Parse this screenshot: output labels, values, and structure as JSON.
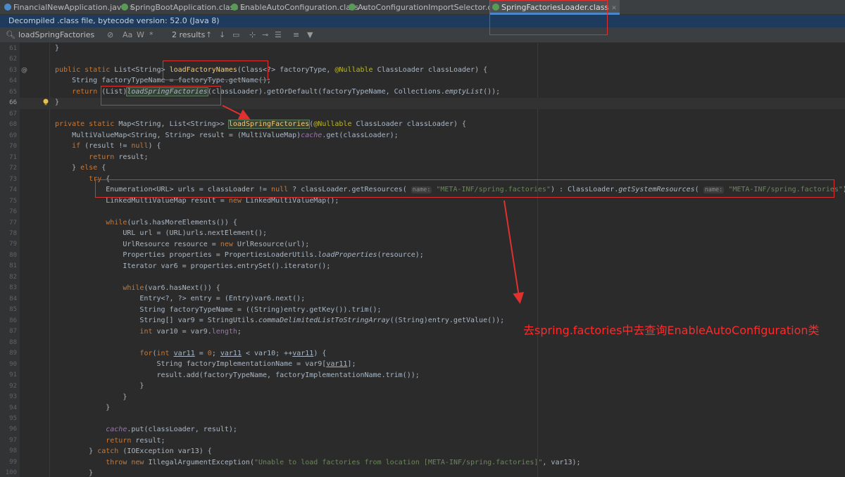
{
  "tabs": [
    {
      "label": "FinancialNewApplication.java",
      "kind": "java"
    },
    {
      "label": "SpringBootApplication.class",
      "kind": "class"
    },
    {
      "label": "EnableAutoConfiguration.class",
      "kind": "class"
    },
    {
      "label": "AutoConfigurationImportSelector.class",
      "kind": "class"
    },
    {
      "label": "SpringFactoriesLoader.class",
      "kind": "class",
      "active": true
    }
  ],
  "banner": "Decompiled .class file, bytecode version: 52.0 (Java 8)",
  "find": {
    "query": "loadSpringFactories",
    "results": "2 results",
    "case_label": "Aa",
    "word_label": "W",
    "regex_label": "*"
  },
  "line_numbers": [
    "61",
    "62",
    "63",
    "64",
    "65",
    "66",
    "67",
    "68",
    "69",
    "70",
    "71",
    "72",
    "73",
    "74",
    "75",
    "76",
    "77",
    "78",
    "79",
    "80",
    "81",
    "82",
    "83",
    "84",
    "85",
    "86",
    "87",
    "88",
    "89",
    "90",
    "91",
    "92",
    "93",
    "94",
    "95",
    "96",
    "97",
    "98",
    "99",
    "100"
  ],
  "current_line": "66",
  "hints": {
    "name": "name:"
  },
  "strings": {
    "meta_inf": "\"META-INF/spring.factories\"",
    "err": "\"Unable to load factories from location [META-INF/spring.factories]\""
  },
  "annotation_note": "去spring.factories中去查询EnableAutoConfiguration类",
  "colors": {
    "background": "#2b2b2b",
    "keyword": "#cc7832",
    "string": "#6a8759",
    "method": "#ffc66d",
    "annotation_red": "#e03030"
  }
}
